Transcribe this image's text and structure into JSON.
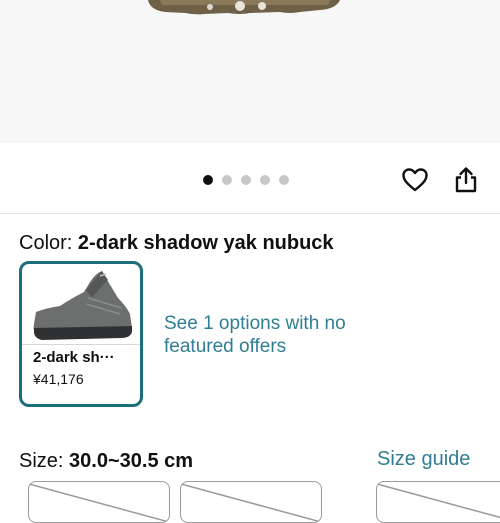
{
  "gallery": {
    "image_count": 5,
    "active_index": 0
  },
  "icons": {
    "wishlist": "heart-icon",
    "share": "share-icon"
  },
  "color": {
    "label": "Color:",
    "value": "2-dark shadow yak nubuck",
    "swatch": {
      "name": "2-dark sh···",
      "price": "¥41,176"
    },
    "see_offers_text": "See 1 options with no featured offers"
  },
  "size": {
    "label": "Size:",
    "value": "30.0~30.5 cm",
    "guide_link": "Size guide"
  },
  "colors": {
    "link": "#2f7e93",
    "selected_border": "#1c6e7a",
    "text": "#0f1111"
  }
}
